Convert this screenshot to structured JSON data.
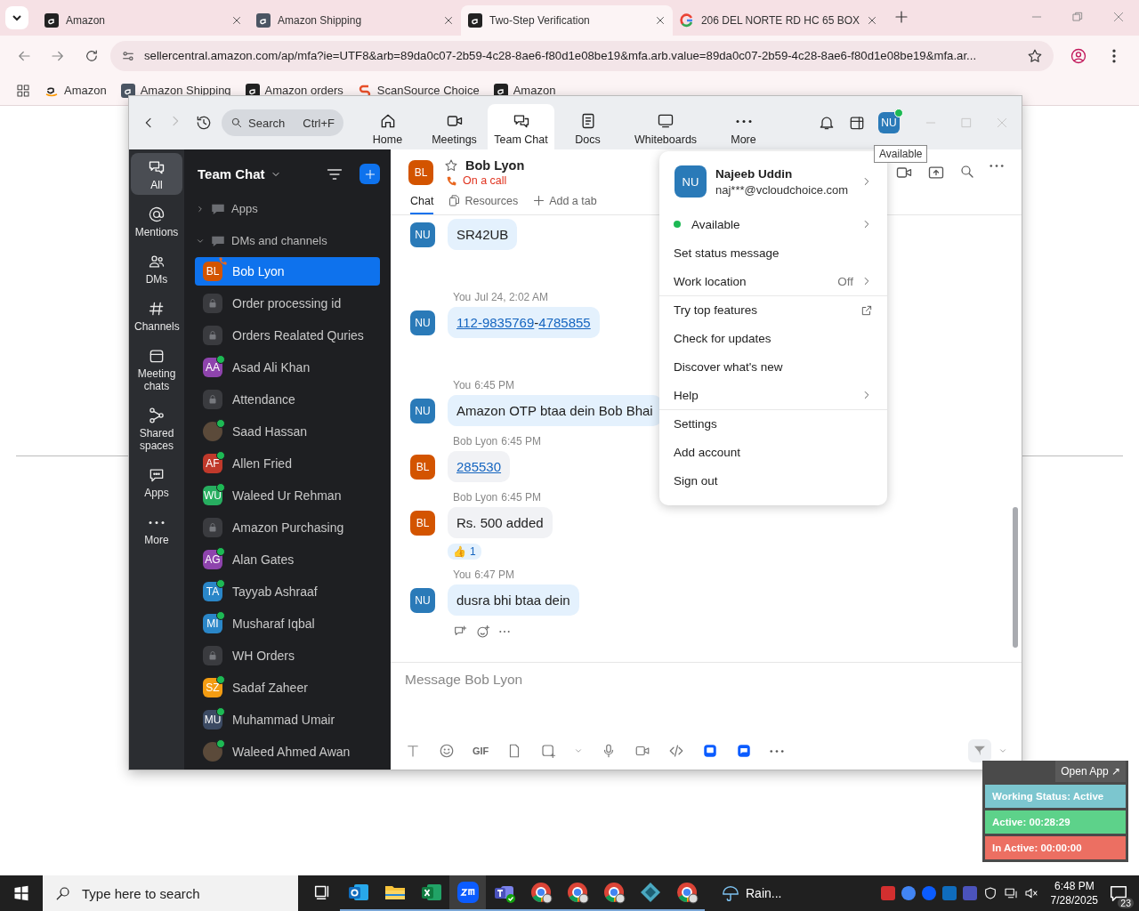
{
  "browser": {
    "tabs": [
      {
        "title": "Amazon",
        "selected": false
      },
      {
        "title": "Amazon Shipping",
        "selected": false
      },
      {
        "title": "Two-Step Verification",
        "selected": true
      },
      {
        "title": "206 DEL NORTE RD HC 65 BOX",
        "selected": false
      }
    ],
    "address": "sellercentral.amazon.com/ap/mfa?ie=UTF8&arb=89da0c07-2b59-4c28-8ae6-f80d1e08be19&mfa.arb.value=89da0c07-2b59-4c28-8ae6-f80d1e08be19&mfa.ar...",
    "bookmarks": [
      "Amazon",
      "Amazon Shipping",
      "Amazon orders",
      "ScanSource Choice",
      "Amazon"
    ]
  },
  "zoom": {
    "topbar": {
      "search": "Search",
      "shortcut": "Ctrl+F",
      "avatar": "NU",
      "tabs": [
        {
          "label": "Home",
          "selected": false
        },
        {
          "label": "Meetings",
          "selected": false
        },
        {
          "label": "Team Chat",
          "selected": true
        },
        {
          "label": "Docs",
          "selected": false
        },
        {
          "label": "Whiteboards",
          "selected": false
        },
        {
          "label": "More",
          "selected": false
        }
      ]
    },
    "tooltip": "Available",
    "rail": [
      {
        "label": "All",
        "selected": true
      },
      {
        "label": "Mentions",
        "selected": false
      },
      {
        "label": "DMs",
        "selected": false
      },
      {
        "label": "Channels",
        "selected": false
      },
      {
        "label": "Meeting chats",
        "selected": false
      },
      {
        "label": "Shared spaces",
        "selected": false
      },
      {
        "label": "Apps",
        "selected": false
      },
      {
        "label": "More",
        "selected": false
      }
    ],
    "list": {
      "title": "Team Chat",
      "sections": [
        {
          "label": "Apps",
          "expanded": false
        },
        {
          "label": "DMs and channels",
          "expanded": true
        }
      ],
      "items": [
        {
          "name": "Bob Lyon",
          "kind": "person",
          "initials": "BL",
          "color": "#d35400",
          "online": false,
          "on_call": true,
          "selected": true
        },
        {
          "name": "Order processing id",
          "kind": "channel",
          "online": false,
          "on_call": false,
          "selected": false
        },
        {
          "name": "Orders Realated Quries",
          "kind": "channel",
          "online": false,
          "on_call": false,
          "selected": false
        },
        {
          "name": "Asad Ali Khan",
          "kind": "person",
          "initials": "AA",
          "color": "#8e44ad",
          "online": true,
          "on_call": false,
          "selected": false
        },
        {
          "name": "Attendance",
          "kind": "channel",
          "online": false,
          "on_call": false,
          "selected": false
        },
        {
          "name": "Saad Hassan",
          "kind": "photo",
          "online": true,
          "on_call": false,
          "selected": false
        },
        {
          "name": "Allen Fried",
          "kind": "person",
          "initials": "AF",
          "color": "#c0392b",
          "online": true,
          "on_call": false,
          "selected": false
        },
        {
          "name": "Waleed Ur Rehman",
          "kind": "person",
          "initials": "WU",
          "color": "#27ae60",
          "online": true,
          "on_call": false,
          "selected": false
        },
        {
          "name": "Amazon Purchasing",
          "kind": "channel",
          "online": false,
          "on_call": false,
          "selected": false
        },
        {
          "name": "Alan Gates",
          "kind": "person",
          "initials": "AG",
          "color": "#8e44ad",
          "online": true,
          "on_call": false,
          "selected": false
        },
        {
          "name": "Tayyab Ashraaf",
          "kind": "person",
          "initials": "TA",
          "color": "#2a86c8",
          "online": true,
          "on_call": false,
          "selected": false
        },
        {
          "name": "Musharaf Iqbal",
          "kind": "person",
          "initials": "MI",
          "color": "#2a86c8",
          "online": true,
          "on_call": false,
          "selected": false
        },
        {
          "name": "WH Orders",
          "kind": "channel",
          "online": false,
          "on_call": false,
          "selected": false
        },
        {
          "name": "Sadaf Zaheer",
          "kind": "person",
          "initials": "SZ",
          "color": "#f39c12",
          "online": true,
          "on_call": false,
          "selected": false
        },
        {
          "name": "Muhammad Umair",
          "kind": "person",
          "initials": "MU",
          "color": "#3b4a63",
          "online": true,
          "on_call": false,
          "selected": false
        },
        {
          "name": "Waleed Ahmed Awan",
          "kind": "photo",
          "online": true,
          "on_call": false,
          "selected": false
        }
      ]
    },
    "chat": {
      "name": "Bob Lyon",
      "initials": "BL",
      "color": "#d35400",
      "status": "On a call",
      "starred": false,
      "tabs": [
        {
          "label": "Chat",
          "selected": true
        },
        {
          "label": "Resources",
          "selected": false
        },
        {
          "label": "Add a tab",
          "selected": false
        }
      ],
      "messages": [
        {
          "initials": "NU",
          "color": "#2a7ab8",
          "mine": true,
          "actions": false,
          "parts": [
            {
              "text": "SR42UB",
              "link": false
            }
          ]
        },
        {
          "initials": "NU",
          "color": "#2a7ab8",
          "mine": true,
          "actions": false,
          "sender": "You",
          "time": "Jul 24, 2:02 AM",
          "parts": [
            {
              "text": "112-9835769",
              "link": true
            },
            {
              "text": "-",
              "link": false
            },
            {
              "text": "4785855",
              "link": true
            }
          ]
        },
        {
          "initials": "NU",
          "color": "#2a7ab8",
          "mine": true,
          "actions": false,
          "sender": "You",
          "time": "6:45 PM",
          "parts": [
            {
              "text": "Amazon OTP btaa dein Bob Bhai",
              "link": false
            }
          ]
        },
        {
          "initials": "BL",
          "color": "#d35400",
          "mine": false,
          "actions": false,
          "sender": "Bob Lyon",
          "time": "6:45 PM",
          "parts": [
            {
              "text": "285530",
              "link": true
            }
          ]
        },
        {
          "initials": "BL",
          "color": "#d35400",
          "mine": false,
          "actions": false,
          "sender": "Bob Lyon",
          "time": "6:45 PM",
          "parts": [
            {
              "text": "Rs. 500 added",
              "link": false
            }
          ],
          "reaction": {
            "emoji": "👍",
            "count": "1"
          }
        },
        {
          "initials": "NU",
          "color": "#2a7ab8",
          "mine": true,
          "actions": true,
          "sender": "You",
          "time": "6:47 PM",
          "parts": [
            {
              "text": "dusra bhi btaa dein",
              "link": false
            }
          ]
        }
      ],
      "composer": {
        "placeholder": "Message Bob Lyon",
        "gif": "GIF"
      }
    },
    "menu": {
      "name": "Najeeb Uddin",
      "email": "naj***@vcloudchoice.com",
      "initials": "NU",
      "items": [
        {
          "label": "Available",
          "kind": "status",
          "submenu": true,
          "external": false
        },
        {
          "label": "Set status message",
          "kind": "item",
          "submenu": false,
          "external": false
        },
        {
          "label": "Work location",
          "kind": "item",
          "value": "Off",
          "submenu": true,
          "external": false
        },
        {
          "label": "Try top features",
          "kind": "item",
          "submenu": false,
          "external": true
        },
        {
          "label": "Check for updates",
          "kind": "item",
          "submenu": false,
          "external": false
        },
        {
          "label": "Discover what's new",
          "kind": "item",
          "submenu": false,
          "external": false
        },
        {
          "label": "Help",
          "kind": "item",
          "submenu": true,
          "external": false
        },
        {
          "label": "Settings",
          "kind": "item",
          "submenu": false,
          "external": false
        },
        {
          "label": "Add account",
          "kind": "item",
          "submenu": false,
          "external": false
        },
        {
          "label": "Sign out",
          "kind": "item",
          "submenu": false,
          "external": false
        }
      ]
    }
  },
  "widget": {
    "button": "Open App ↗",
    "rows": [
      {
        "label": "Working Status: Active",
        "color": "#7cc6cf"
      },
      {
        "label": "Active: 00:28:29",
        "color": "#5dd28a"
      },
      {
        "label": "In Active: 00:00:00",
        "color": "#ec6f62"
      }
    ]
  },
  "taskbar": {
    "search": "Type here to search",
    "apps": [
      {
        "selected": false
      },
      {
        "selected": false
      },
      {
        "selected": false
      },
      {
        "selected": false
      },
      {
        "selected": true
      },
      {
        "selected": false
      },
      {
        "selected": false
      },
      {
        "selected": false
      },
      {
        "selected": false
      },
      {
        "selected": false
      },
      {
        "selected": false
      }
    ],
    "weather": "Rain...",
    "time": "6:48 PM",
    "date": "7/28/2025",
    "notifications": "23"
  }
}
